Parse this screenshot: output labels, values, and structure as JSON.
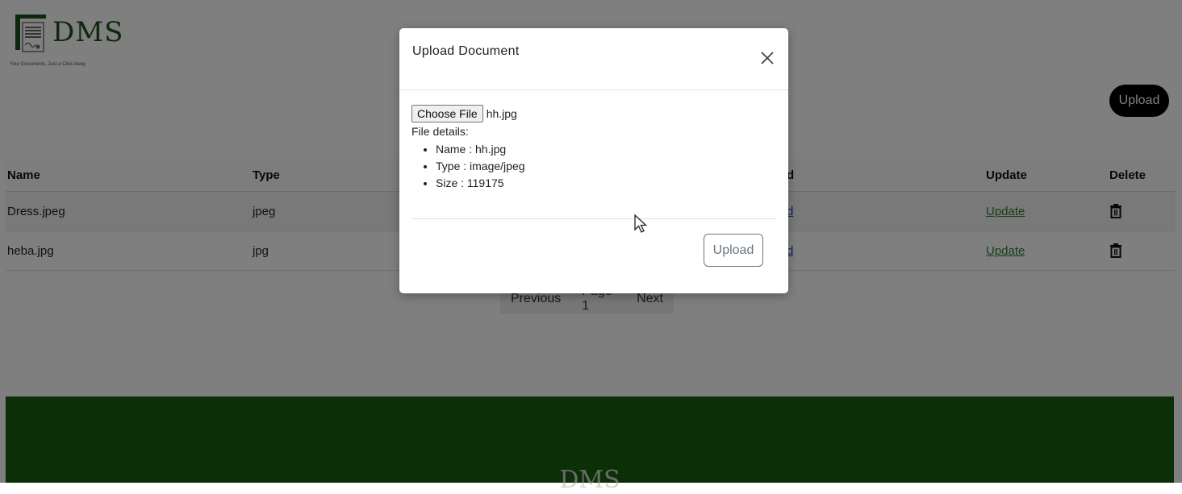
{
  "brand": {
    "name": "DMS",
    "tagline": "Your Documents, Just a Click Away"
  },
  "toolbar": {
    "upload_label": "Upload"
  },
  "table": {
    "headers": {
      "name": "Name",
      "type": "Type",
      "download": "d",
      "update": "Update",
      "delete": "Delete"
    },
    "rows": [
      {
        "name": "Dress.jpeg",
        "type": "jpeg",
        "download": "d",
        "update": "Update"
      },
      {
        "name": "heba.jpg",
        "type": "jpg",
        "download": "d",
        "update": "Update"
      }
    ]
  },
  "pagination": {
    "previous": "Previous",
    "page": "Page 1",
    "next": "Next"
  },
  "footer": {
    "title": "DMS"
  },
  "modal": {
    "title": "Upload Document",
    "choose_label": "Choose File",
    "file_name": "hh.jpg",
    "details_label": "File details:",
    "details": [
      "Name : hh.jpg",
      "Type : image/jpeg",
      "Size : 119175"
    ],
    "upload_label": "Upload"
  },
  "colors": {
    "brand_green": "#1a5e0f",
    "link_blue": "#1a3fd0",
    "link_green": "#2e7d32",
    "primary_button": "#000000"
  },
  "icons": {
    "close": "close-icon",
    "delete": "trash-icon",
    "cursor": "mouse-pointer-icon"
  }
}
